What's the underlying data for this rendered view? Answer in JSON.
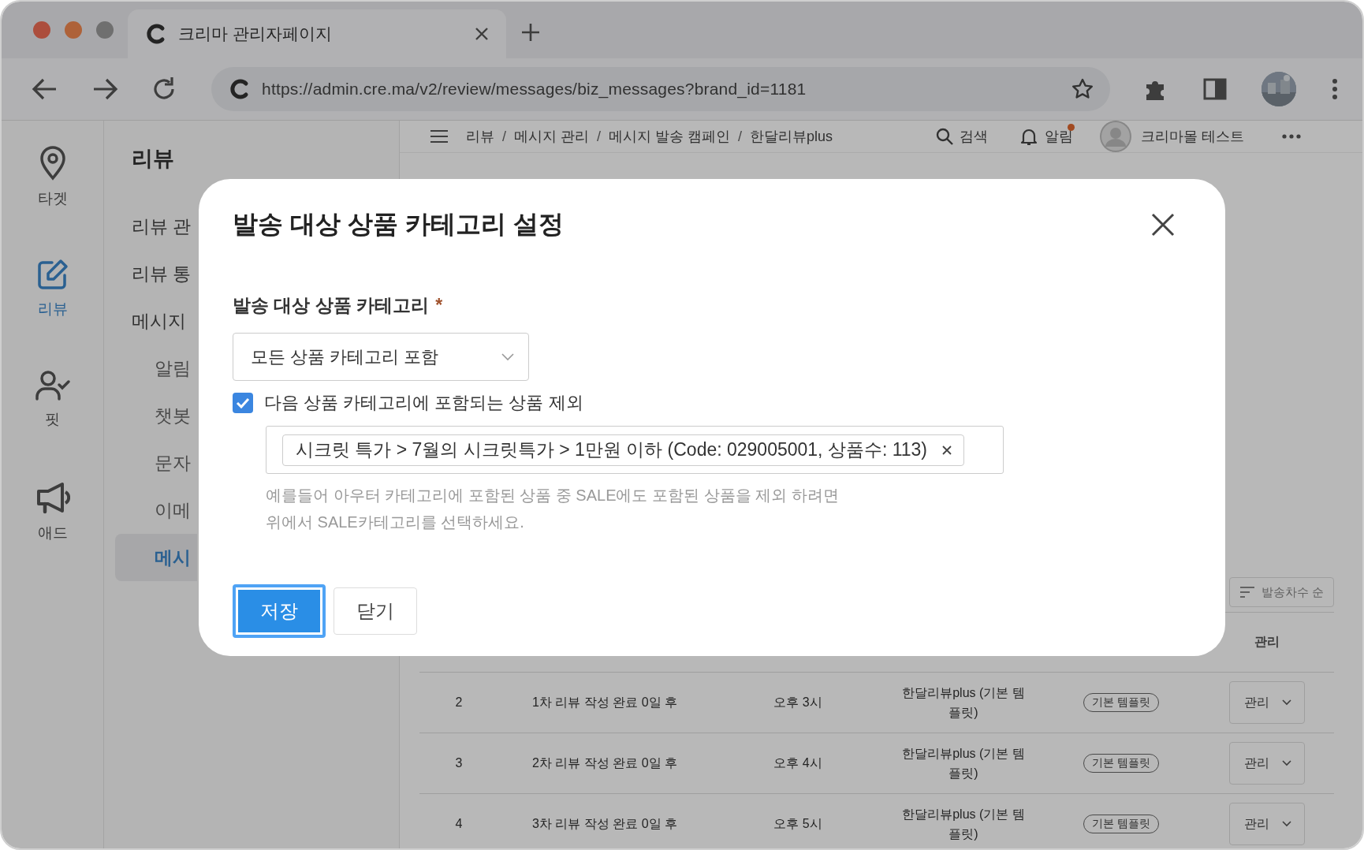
{
  "browser": {
    "tab_title": "크리마 관리자페이지",
    "url": "https://admin.cre.ma/v2/review/messages/biz_messages?brand_id=1181"
  },
  "rail": [
    {
      "kind": "pin",
      "label": "타겟",
      "selected": false
    },
    {
      "kind": "edit",
      "label": "리뷰",
      "selected": true
    },
    {
      "kind": "user",
      "label": "핏",
      "selected": false
    },
    {
      "kind": "megaphone",
      "label": "애드",
      "selected": false
    }
  ],
  "menu": {
    "title": "리뷰",
    "items": [
      {
        "label": "리뷰 관",
        "selected": false
      },
      {
        "label": "리뷰 통",
        "selected": false
      },
      {
        "label": "메시지",
        "selected": false,
        "children": [
          {
            "label": "알림",
            "selected": false
          },
          {
            "label": "챗봇",
            "selected": false
          },
          {
            "label": "문자",
            "selected": false
          },
          {
            "label": "이메",
            "selected": false
          },
          {
            "label": "메시",
            "selected": true
          }
        ]
      }
    ]
  },
  "header": {
    "breadcrumbs": [
      "리뷰",
      "메시지 관리",
      "메시지 발송 캠페인",
      "한달리뷰plus"
    ],
    "separator": "/",
    "search": "검색",
    "alarm": "알림",
    "alarm_has_new": true,
    "user": "크리마몰 테스트"
  },
  "table": {
    "sort_label": "발송차수 순",
    "manage_header": "관리",
    "rows": [
      {
        "id": "2",
        "trigger": "1차 리뷰 작성 완료 0일 후",
        "time": "오후 3시",
        "template": "한달리뷰plus (기본 템플릿)",
        "status": "기본 템플릿",
        "action": "관리"
      },
      {
        "id": "3",
        "trigger": "2차 리뷰 작성 완료 0일 후",
        "time": "오후 4시",
        "template": "한달리뷰plus (기본 템플릿)",
        "status": "기본 템플릿",
        "action": "관리"
      },
      {
        "id": "4",
        "trigger": "3차 리뷰 작성 완료 0일 후",
        "time": "오후 5시",
        "template": "한달리뷰plus (기본 템플릿)",
        "status": "기본 템플릿",
        "action": "관리"
      }
    ]
  },
  "modal": {
    "title": "발송 대상 상품 카테고리 설정",
    "field_label": "발송 대상 상품 카테고리",
    "required_mark": "*",
    "select_value": "모든 상품 카테고리 포함",
    "exclude": {
      "label": "다음 상품 카테고리에 포함되는 상품 제외",
      "checked": true
    },
    "tags": [
      {
        "label": "시크릿 특가 > 7월의 시크릿특가 > 1만원 이하 (Code: 029005001, 상품수: 113)"
      }
    ],
    "help_lines": [
      "예를들어 아우터 카테고리에 포함된 상품 중 SALE에도 포함된 상품을 제외 하려면",
      "위에서 SALE카테고리를 선택하세요."
    ],
    "buttons": [
      {
        "label": "저장",
        "kind": "primary",
        "focused": true
      },
      {
        "label": "닫기",
        "kind": "secondary",
        "focused": false
      }
    ]
  }
}
